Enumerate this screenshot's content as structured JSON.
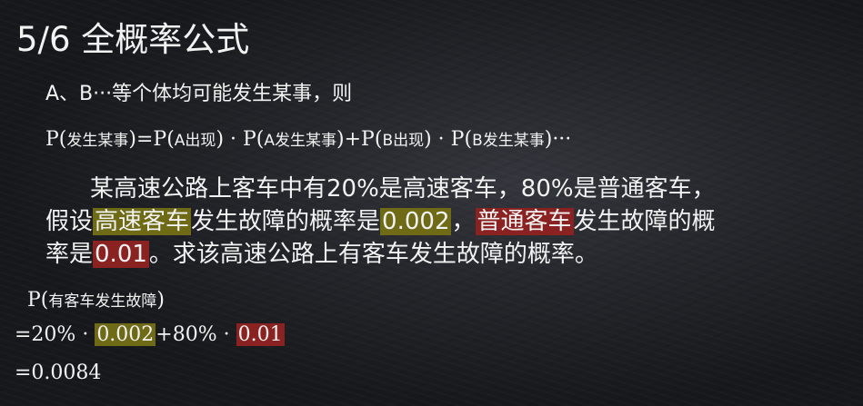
{
  "slide": {
    "title": "5/6 全概率公式",
    "premise": "A、B···等个体均可能发生某事，则",
    "formula": {
      "p1": "P(",
      "event": "发生某事",
      "eq": ")=P(",
      "a_appear": "A出现",
      "dot1": ") · P(",
      "a_event": "A发生某事",
      "plus": ")+P(",
      "b_appear": "B出现",
      "dot2": ") · P(",
      "b_event": "B发生某事",
      "tail": ")···"
    },
    "problem": {
      "line1": "某高速公路上客车中有20%是高速客车，80%是普通客车，",
      "line2_a": "假设",
      "hl_express": "高速客车",
      "line2_b": "发生故障的概率是",
      "hl_p1": "0.002",
      "line2_c": "，",
      "hl_normal": "普通客车",
      "line2_d": "发生故障的概",
      "line3_a": "率是",
      "hl_p2": "0.01",
      "line3_b": "。求该高速公路上有客车发生故障的概率。"
    },
    "solution": {
      "p_open": "P(",
      "event": "有客车发生故障",
      "p_close": ")",
      "step2_a": "=20% · ",
      "step2_hl1": "0.002",
      "step2_b": "+80% · ",
      "step2_hl2": "0.01",
      "step3": "=0.0084"
    },
    "colors": {
      "highlight_yellow": "#6e6a16",
      "highlight_red": "#8a2222",
      "text": "#f2f2f2"
    }
  }
}
